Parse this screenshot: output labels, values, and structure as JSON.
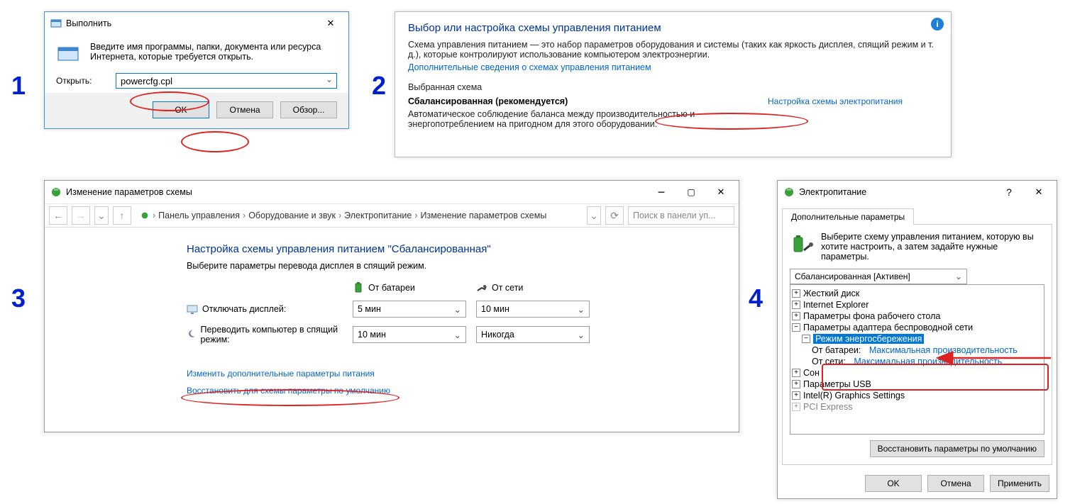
{
  "steps": {
    "s1": "1",
    "s2": "2",
    "s3": "3",
    "s4": "4"
  },
  "run": {
    "title": "Выполнить",
    "prompt": "Введите имя программы, папки, документа или ресурса Интернета, которые требуется открыть.",
    "open_label": "Открыть:",
    "command": "powercfg.cpl",
    "ok": "OK",
    "cancel": "Отмена",
    "browse": "Обзор..."
  },
  "pwr": {
    "heading": "Выбор или настройка схемы управления питанием",
    "desc": "Схема управления питанием — это набор параметров оборудования и системы (таких как яркость дисплея, спящий режим и т. д.), которые контролируют использование компьютером электроэнергии.",
    "more_link": "Дополнительные сведения о схемах управления питанием",
    "selected_label": "Выбранная схема",
    "plan_name": "Сбалансированная (рекомендуется)",
    "plan_desc": "Автоматическое соблюдение баланса между производительностью и энергопотреблением на пригодном для этого оборудовании.",
    "settings_link": "Настройка схемы электропитания"
  },
  "edit": {
    "title": "Изменение параметров схемы",
    "crumb": {
      "cp": "Панель управления",
      "hw": "Оборудование и звук",
      "pw": "Электропитание",
      "ep": "Изменение параметров схемы"
    },
    "search_placeholder": "Поиск в панели уп...",
    "heading": "Настройка схемы управления питанием \"Сбалансированная\"",
    "sub": "Выберите параметры перевода дисплея в спящий режим.",
    "col_battery": "От батареи",
    "col_ac": "От сети",
    "row_display": "Отключать дисплей:",
    "row_sleep": "Переводить компьютер в спящий режим:",
    "val_5min": "5 мин",
    "val_10min": "10 мин",
    "val_never": "Никогда",
    "link_advanced": "Изменить дополнительные параметры питания",
    "link_restore": "Восстановить для схемы параметры по умолчанию"
  },
  "adv": {
    "title": "Электропитание",
    "tab": "Дополнительные параметры",
    "instruction": "Выберите схему управления питанием, которую вы хотите настроить, а затем задайте нужные параметры.",
    "plan_selected": "Сбалансированная [Активен]",
    "tree": {
      "hdd": "Жесткий диск",
      "ie": "Internet Explorer",
      "wallpaper": "Параметры фона рабочего стола",
      "wifi": "Параметры адаптера беспроводной сети",
      "power_mode": "Режим энергосбережения",
      "battery_label": "От батареи:",
      "ac_label": "От сети:",
      "max_perf": "Максимальная производительность",
      "sleep": "Сон",
      "usb": "Параметры USB",
      "gfx": "Intel(R) Graphics Settings",
      "pci": "PCI Express"
    },
    "restore": "Восстановить параметры по умолчанию",
    "ok": "OK",
    "cancel": "Отмена",
    "apply": "Применить"
  }
}
